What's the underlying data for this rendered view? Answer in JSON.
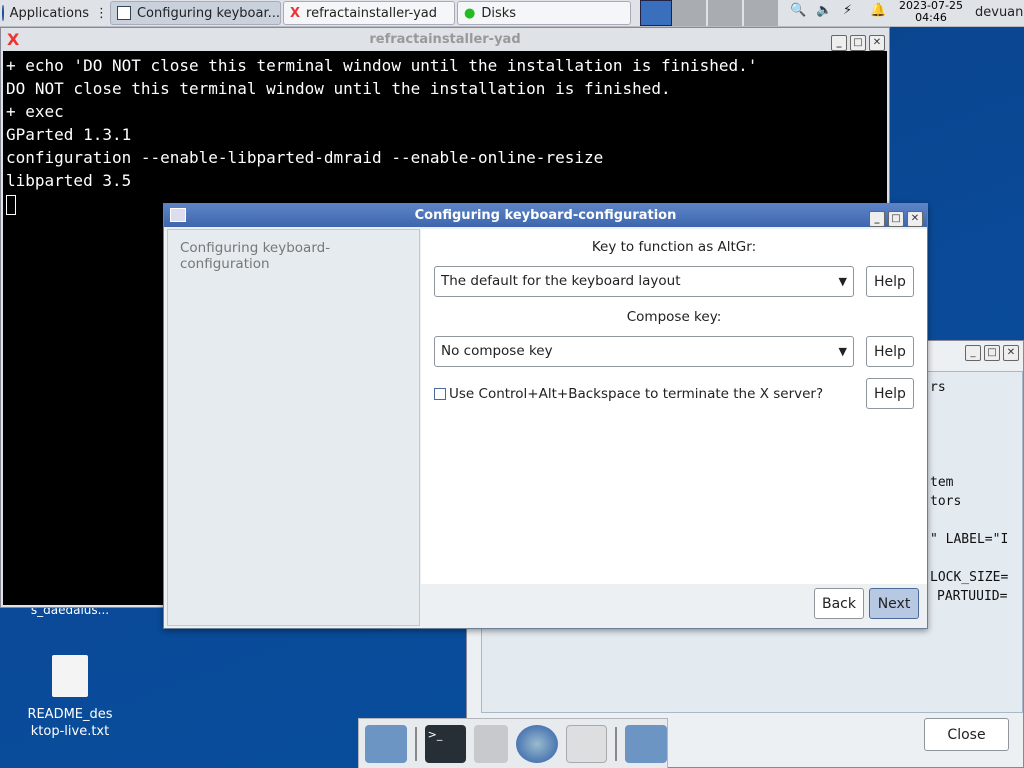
{
  "taskbar": {
    "apps_label": "Applications",
    "tasks": [
      {
        "label": "Configuring keyboar...",
        "icon": "window-icon"
      },
      {
        "label": "refractainstaller-yad",
        "icon": "refracta-icon"
      },
      {
        "label": "Disks",
        "icon": "disks-icon"
      }
    ],
    "date": "2023-07-25",
    "time": "04:46",
    "user": "devuan"
  },
  "terminal": {
    "title": "refractainstaller-yad",
    "lines": [
      "+ echo 'DO NOT close this terminal window until the installation is finished.'",
      "DO NOT close this terminal window until the installation is finished.",
      "+ exec",
      "GParted 1.3.1",
      "configuration --enable-libparted-dmraid --enable-online-resize",
      "libparted 3.5"
    ]
  },
  "back_window": {
    "lines": [
      "rs",
      "tem",
      "tors",
      "\" LABEL=\"I",
      "LOCK_SIZE=",
      "PARTUUID="
    ],
    "close_label": "Close"
  },
  "dialog": {
    "title": "Configuring keyboard-configuration",
    "sidebar_label": "Configuring keyboard-configuration",
    "altgr_label": "Key to function as AltGr:",
    "altgr_value": "The default for the keyboard layout",
    "compose_label": "Compose key:",
    "compose_value": "No compose key",
    "checkbox_label": "Use Control+Alt+Backspace to terminate the X server?",
    "checkbox_checked": false,
    "help_label": "Help",
    "back_label": "Back",
    "next_label": "Next"
  },
  "desktop": {
    "icons": [
      {
        "label": "s_daedalus..."
      },
      {
        "label": "README_desktop-live.txt",
        "line1": "README_des",
        "line2": "ktop-live.txt"
      }
    ]
  },
  "colors": {
    "titlebar_active": "#4a72b8",
    "desktop": "#0a4a98"
  }
}
